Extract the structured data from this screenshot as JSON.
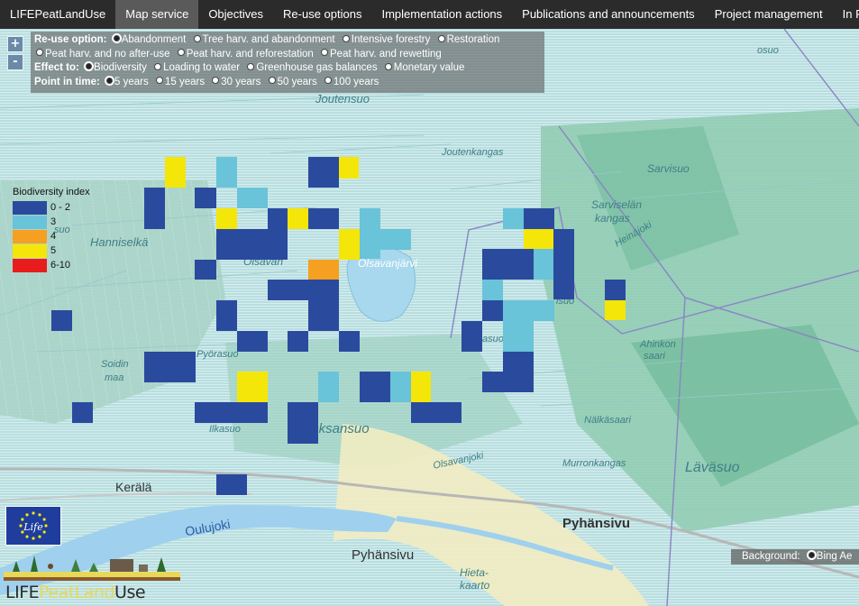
{
  "nav": {
    "items": [
      "LIFEPeatLandUse",
      "Map service",
      "Objectives",
      "Re-use options",
      "Implementation actions",
      "Publications and announcements",
      "Project management",
      "In Finnish"
    ],
    "active_index": 1
  },
  "zoom": {
    "in_label": "+",
    "out_label": "-"
  },
  "panel": {
    "reuse_title": "Re-use option:",
    "reuse_options": [
      "Abandonment",
      "Tree harv. and abandonment",
      "Intensive forestry",
      "Restoration",
      "Peat harv. and no after-use",
      "Peat harv. and reforestation",
      "Peat harv. and rewetting"
    ],
    "reuse_selected": 0,
    "effect_title": "Effect to:",
    "effect_options": [
      "Biodiversity",
      "Loading to water",
      "Greenhouse gas balances",
      "Monetary value"
    ],
    "effect_selected": 0,
    "time_title": "Point in time:",
    "time_options": [
      "5 years",
      "15 years",
      "30 years",
      "50 years",
      "100 years"
    ],
    "time_selected": 0
  },
  "legend": {
    "title": "Biodiversity index",
    "items": [
      {
        "label": "0 - 2",
        "color": "#2a4a9e"
      },
      {
        "label": "3",
        "color": "#69c3d9"
      },
      {
        "label": "4",
        "color": "#f5a020"
      },
      {
        "label": "5",
        "color": "#f5e60a"
      },
      {
        "label": "6-10",
        "color": "#e81c1c"
      }
    ]
  },
  "map_labels": {
    "joutensuo": "Joutensuo",
    "joutenkangas": "Joutenkangas",
    "sarvisuo": "Sarvisuo",
    "sarviselan": "Sarviselän",
    "kangas": "kangas",
    "hanniselka": "Hanniselkä",
    "olsavanjarvi": "Olsavanjärvi",
    "ohsavan": "Olsavan",
    "heinajoki": "Heinäjoki",
    "ahinkon": "Ahinkon",
    "saari": "saari",
    "soidin": "Soidin",
    "maa": "maa",
    "pyorasuo": "Pyörasuo",
    "ilkasuo": "Ilkasuo",
    "oksansuo": "Oksansuo",
    "olsavanjoki": "Olsavanjoki",
    "nalkasaari": "Nälkäsaari",
    "murronkangas": "Murronkangas",
    "lavasuo": "Läväsuo",
    "kerala": "Kerälä",
    "oulujoki": "Oulujoki",
    "pyhansivu1": "Pyhänsivu",
    "pyhansivu2": "Pyhänsivu",
    "hietakaarto1": "Hieta-",
    "hietakaarto2": "kaarto",
    "suo": "suo",
    "asuo": "asuo",
    "isuo": "isuo",
    "esuo": "osuo",
    "kangas2": "kangas"
  },
  "grid_colors": {
    "dark": "#2a4a9e",
    "light": "#69c3d9",
    "orange": "#f5a020",
    "yellow": "#f5e60a"
  },
  "background": {
    "label": "Background:",
    "option": "Bing Ae"
  },
  "logos": {
    "life": "Life",
    "brand_a": "LIFE",
    "brand_b": "PeatLand",
    "brand_c": "Use"
  }
}
